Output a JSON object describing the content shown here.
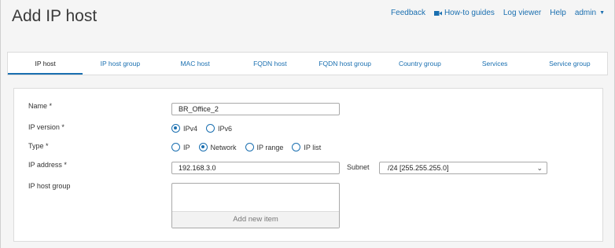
{
  "page": {
    "title": "Add IP host"
  },
  "topnav": {
    "feedback": "Feedback",
    "howto": "How-to guides",
    "logviewer": "Log viewer",
    "help": "Help",
    "user": "admin"
  },
  "tabs": [
    {
      "label": "IP host",
      "active": true
    },
    {
      "label": "IP host group"
    },
    {
      "label": "MAC host"
    },
    {
      "label": "FQDN host"
    },
    {
      "label": "FQDN host group"
    },
    {
      "label": "Country group"
    },
    {
      "label": "Services"
    },
    {
      "label": "Service group"
    }
  ],
  "form": {
    "name_label": "Name *",
    "name_value": "BR_Office_2",
    "ipversion_label": "IP version *",
    "ipversion_options": [
      "IPv4",
      "IPv6"
    ],
    "ipversion_selected": "IPv4",
    "type_label": "Type *",
    "type_options": [
      "IP",
      "Network",
      "IP range",
      "IP list"
    ],
    "type_selected": "Network",
    "ipaddress_label": "IP address *",
    "ipaddress_value": "192.168.3.0",
    "subnet_label": "Subnet",
    "subnet_value": "/24 [255.255.255.0]",
    "hostgroup_label": "IP host group",
    "add_item_label": "Add new item"
  },
  "colors": {
    "accent": "#1a6fb0",
    "background": "#f5f5f5"
  },
  "icons": {
    "howto": "video-camera-icon",
    "user_menu": "caret-down-icon",
    "select": "chevron-down-icon"
  }
}
